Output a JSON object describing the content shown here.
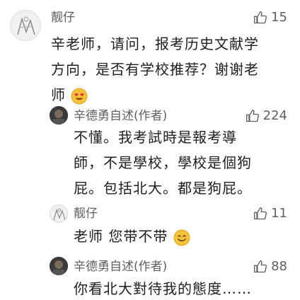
{
  "comments": [
    {
      "author": "靓仔",
      "likes": "15",
      "lines": [
        "辛老师，请问，报考历史文献学",
        "方向，是否有学校推荐？谢谢老",
        "师"
      ],
      "emoji": "heart-eyes-emoji"
    },
    {
      "author": "辛德勇自述(作者)",
      "likes": "224",
      "lines": [
        "不懂。我考試時是報考導",
        "師，不是學校，學校是個狗",
        "屁。包括北大。都是狗屁。"
      ]
    },
    {
      "author": "靓仔",
      "likes": "11",
      "lines": [
        "老师 您带不带"
      ],
      "emoji": "smile-emoji"
    },
    {
      "author": "辛德勇自述(作者)",
      "likes": "88",
      "lines": [
        "你看北大對待我的態度……"
      ]
    }
  ],
  "icons": {
    "like": "thumbs-up-icon"
  },
  "colors": {
    "name": "#5f5f5f",
    "text": "#1e1e1e",
    "background": "#ffffff"
  }
}
